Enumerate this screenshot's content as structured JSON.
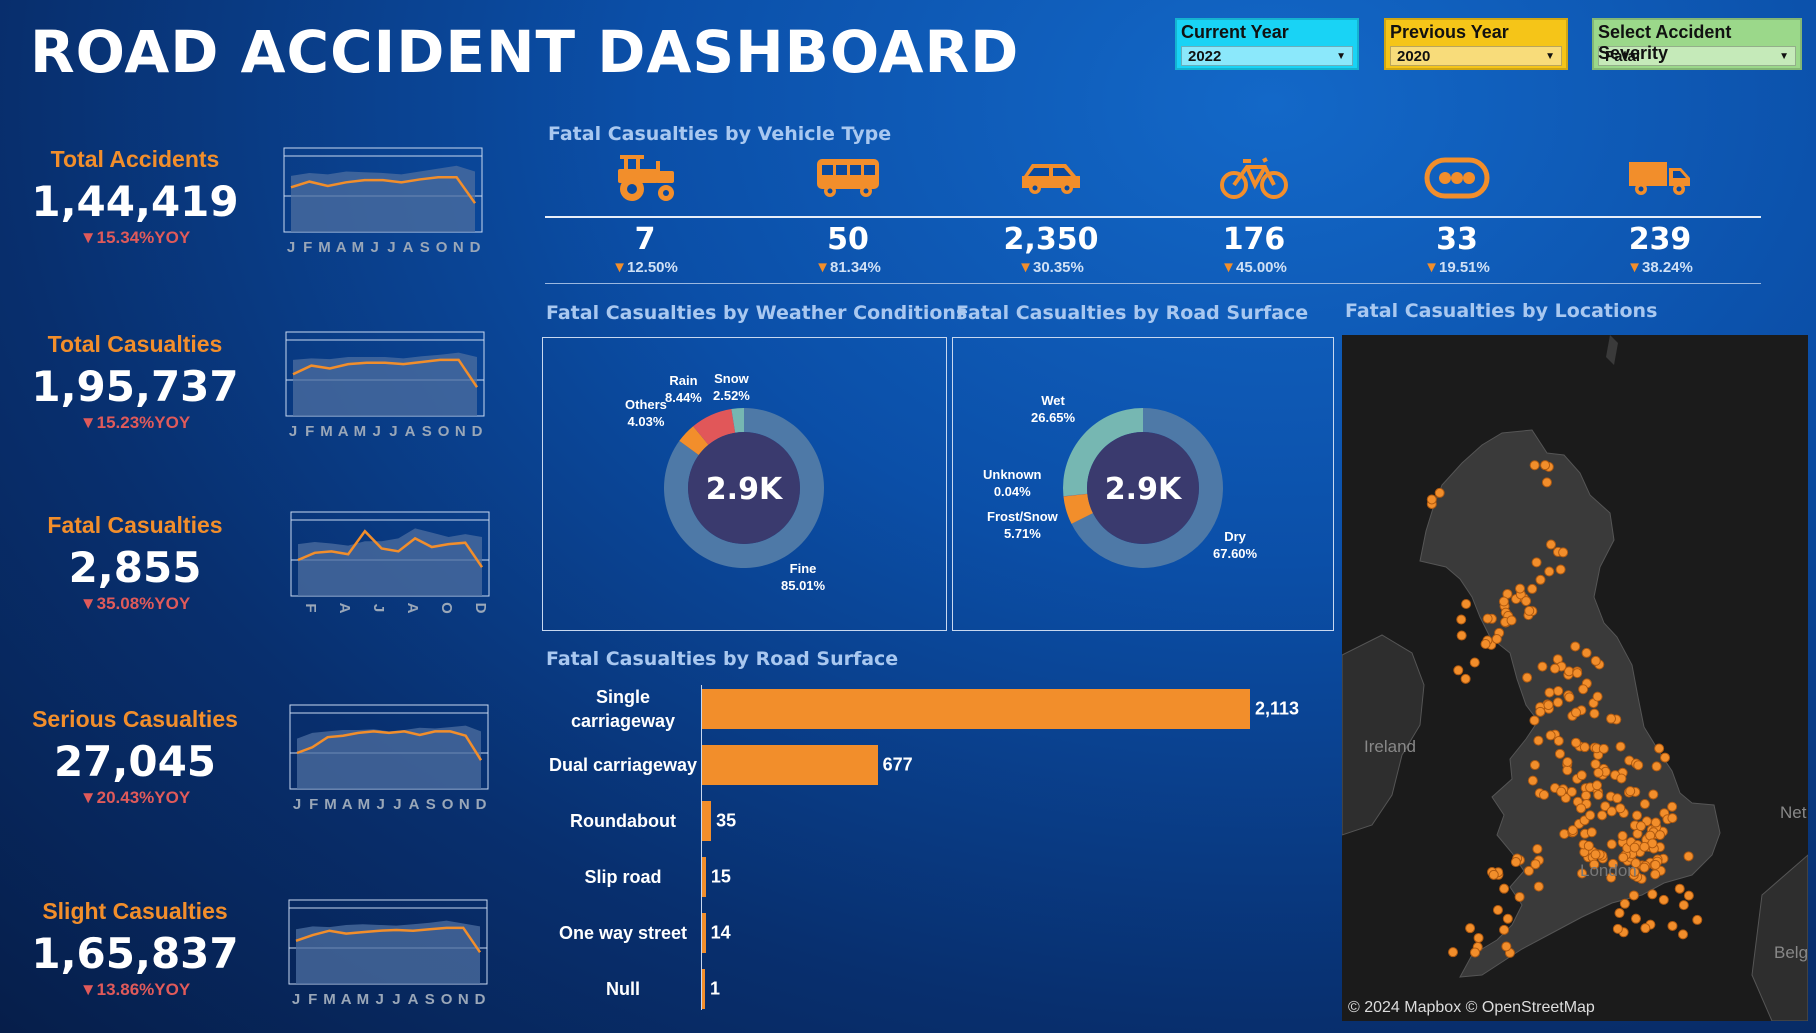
{
  "header": {
    "title": "ROAD ACCIDENT DASHBOARD"
  },
  "filters": [
    {
      "label": "Current Year",
      "value": "2022",
      "color": "#19d3f5",
      "select_color": "#8be8fb"
    },
    {
      "label": "Previous Year",
      "value": "2020",
      "color": "#f5c518",
      "select_color": "#f8dc7a"
    },
    {
      "label": "Select Accident Severity",
      "value": "Fatal",
      "color": "#9bd88a",
      "select_color": "#c5eab9"
    }
  ],
  "kpis": [
    {
      "label": "Total Accidents",
      "value": "1,44,419",
      "yoy": "▼15.34%YOY"
    },
    {
      "label": "Total Casualties",
      "value": "1,95,737",
      "yoy": "▼15.23%YOY"
    },
    {
      "label": "Fatal Casualties",
      "value": "2,855",
      "yoy": "▼35.08%YOY"
    },
    {
      "label": "Serious Casualties",
      "value": "27,045",
      "yoy": "▼20.43%YOY"
    },
    {
      "label": "Slight Casualties",
      "value": "1,65,837",
      "yoy": "▼13.86%YOY"
    }
  ],
  "sparklines": {
    "months": [
      "J",
      "F",
      "M",
      "A",
      "M",
      "J",
      "J",
      "A",
      "S",
      "O",
      "N",
      "D"
    ],
    "fatal_months": [
      "F",
      "A",
      "J",
      "A",
      "O",
      "D"
    ],
    "series": [
      {
        "current": [
          62,
          70,
          64,
          69,
          72,
          72,
          69,
          73,
          76,
          76,
          40
        ],
        "previous": [
          78,
          82,
          80,
          84,
          83,
          82,
          80,
          84,
          88,
          92,
          84
        ]
      },
      {
        "current": [
          58,
          70,
          66,
          72,
          74,
          74,
          72,
          75,
          78,
          78,
          40
        ],
        "previous": [
          78,
          80,
          79,
          82,
          82,
          82,
          80,
          83,
          85,
          88,
          82
        ]
      },
      {
        "current": [
          50,
          60,
          62,
          58,
          90,
          66,
          62,
          80,
          68,
          72,
          74,
          40
        ],
        "previous": [
          72,
          75,
          73,
          70,
          76,
          76,
          80,
          94,
          88,
          82,
          86,
          82
        ]
      },
      {
        "current": [
          50,
          58,
          72,
          74,
          78,
          80,
          78,
          80,
          75,
          80,
          80,
          74,
          40
        ],
        "previous": [
          70,
          78,
          80,
          82,
          82,
          83,
          80,
          82,
          85,
          84,
          86,
          88,
          80
        ]
      },
      {
        "current": [
          60,
          68,
          74,
          70,
          72,
          74,
          75,
          74,
          76,
          78,
          78,
          44
        ],
        "previous": [
          76,
          80,
          79,
          82,
          83,
          82,
          81,
          83,
          85,
          88,
          84,
          80
        ]
      }
    ]
  },
  "vehicle_section": {
    "title": "Fatal Casualties by Vehicle Type",
    "items": [
      {
        "icon": "tractor-icon",
        "value": "7",
        "yoy": "12.50%"
      },
      {
        "icon": "bus-icon",
        "value": "50",
        "yoy": "81.34%"
      },
      {
        "icon": "car-icon",
        "value": "2,350",
        "yoy": "30.35%"
      },
      {
        "icon": "bicycle-icon",
        "value": "176",
        "yoy": "45.00%"
      },
      {
        "icon": "other-vehicle-icon",
        "value": "33",
        "yoy": "19.51%"
      },
      {
        "icon": "truck-icon",
        "value": "239",
        "yoy": "38.24%"
      }
    ]
  },
  "weather": {
    "title": "Fatal Casualties by Weather Conditions",
    "center": "2.9K",
    "slices": [
      {
        "name": "Fine",
        "pct": "85.01%",
        "value": 85.01,
        "color": "#4e79a7"
      },
      {
        "name": "Others",
        "pct": "4.03%",
        "value": 4.03,
        "color": "#f28e2b"
      },
      {
        "name": "Rain",
        "pct": "8.44%",
        "value": 8.44,
        "color": "#e15759"
      },
      {
        "name": "Snow",
        "pct": "2.52%",
        "value": 2.52,
        "color": "#76b7b2"
      }
    ]
  },
  "surface": {
    "title": "Fatal Casualties by Road Surface",
    "center": "2.9K",
    "slices": [
      {
        "name": "Dry",
        "pct": "67.60%",
        "value": 67.6,
        "color": "#4e79a7"
      },
      {
        "name": "Frost/Snow",
        "pct": "5.71%",
        "value": 5.71,
        "color": "#f28e2b"
      },
      {
        "name": "Unknown",
        "pct": "0.04%",
        "value": 0.04,
        "color": "#e15759"
      },
      {
        "name": "Wet",
        "pct": "26.65%",
        "value": 26.65,
        "color": "#76b7b2"
      }
    ]
  },
  "road_type": {
    "title": "Fatal Casualties by Road Surface",
    "chart_data": {
      "type": "bar",
      "categories": [
        "Single carriageway",
        "Dual carriageway",
        "Roundabout",
        "Slip road",
        "One way street",
        "Null"
      ],
      "values": [
        2113,
        677,
        35,
        15,
        14,
        1
      ],
      "labels": [
        "2,113",
        "677",
        "35",
        "15",
        "14",
        "1"
      ],
      "color": "#f28e2b"
    }
  },
  "locations": {
    "title": "Fatal Casualties by Locations",
    "credit": "© 2024 Mapbox © OpenStreetMap",
    "places": [
      "Ireland",
      "London",
      "Net",
      "Belg"
    ]
  }
}
